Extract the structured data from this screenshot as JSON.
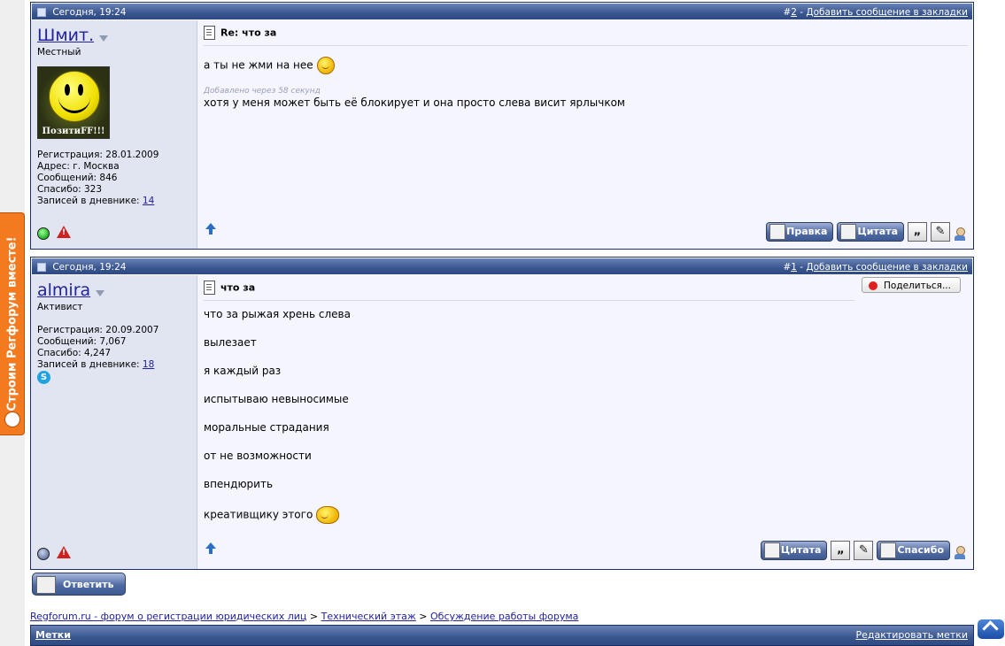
{
  "promo_tab": {
    "text": "Строим Регфорум вместе!"
  },
  "posts": [
    {
      "date": "Сегодня, 19:24",
      "number_prefix": "#",
      "number": "2",
      "separator": " - ",
      "bookmark_label": "Добавить сообщение в закладки",
      "username": "Шмит.",
      "rank": "Местный",
      "avatar_caption": "ПозитиFF!!!",
      "stats": {
        "registration": "Регистрация: 28.01.2009",
        "address": "Адрес: г. Москва",
        "messages": "Сообщений: 846",
        "thanks": "Спасибо: 323",
        "diary_label": "Записей в дневнике:",
        "diary_count": "14"
      },
      "title": "Re: что за",
      "text": "а ты не жми на нее",
      "added_note": "Добавлено через 58 секунд",
      "text2": "хотя у меня может быть её блокирует и она просто слева висит ярлычком",
      "buttons": {
        "edit": "Правка",
        "quote": "Цитата"
      },
      "online_color": "#1fb51f"
    },
    {
      "date": "Сегодня, 19:24",
      "number_prefix": "#",
      "number": "1",
      "separator": " - ",
      "bookmark_label": "Добавить сообщение в закладки",
      "username": "almira",
      "rank": "Активист",
      "stats": {
        "registration": "Регистрация: 20.09.2007",
        "messages": "Сообщений: 7,067",
        "thanks": "Спасибо: 4,247",
        "diary_label": "Записей в дневнике:",
        "diary_count": "18"
      },
      "title": "что за",
      "share_label": "Поделиться...",
      "lines": [
        "что за рыжая хрень слева",
        "вылезает",
        "я каждый раз",
        "испытываю невыносимые",
        "моральные страдания",
        "от не возможности",
        "впендюрить",
        "креативщику этого"
      ],
      "buttons": {
        "quote": "Цитата",
        "thanks": "Спасибо"
      },
      "offline_color": "#6a7ca8"
    }
  ],
  "reply_button": "Ответить",
  "breadcrumb": {
    "items": [
      "Regforum.ru - форум о регистрации юридических лиц",
      "Технический этаж",
      "Обсуждение работы форума"
    ],
    "separator": ">"
  },
  "tags": {
    "label": "Метки",
    "edit_label": "Редактировать метки"
  }
}
